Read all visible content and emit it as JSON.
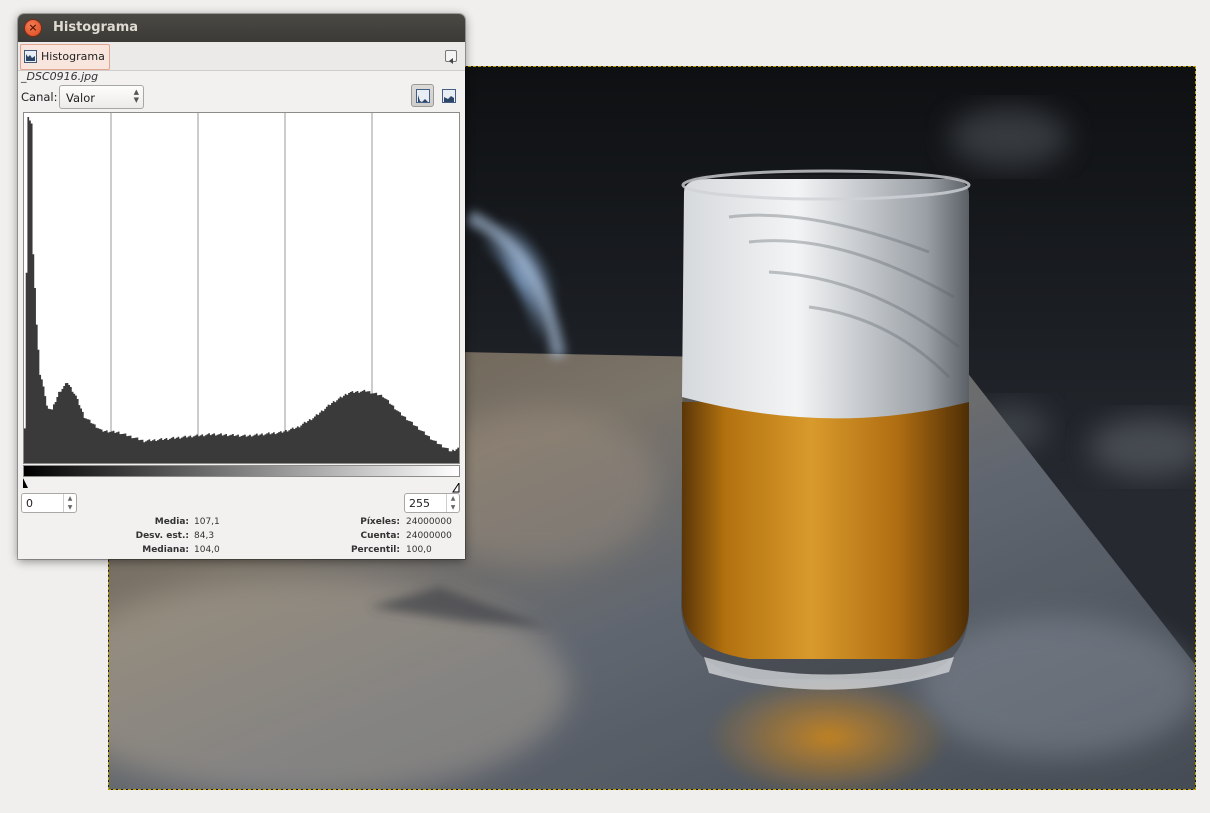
{
  "window": {
    "title": "Histograma"
  },
  "tab": {
    "label": "Histograma"
  },
  "image_name": "_DSC0916.jpg",
  "channel": {
    "label": "Canal:",
    "value": "Valor"
  },
  "range": {
    "low": "0",
    "high": "255"
  },
  "stats": [
    {
      "label": "Media:",
      "value": "107,1"
    },
    {
      "label": "Desv. est.:",
      "value": "84,3"
    },
    {
      "label": "Mediana:",
      "value": "104,0"
    },
    {
      "label": "Píxeles:",
      "value": "24000000"
    },
    {
      "label": "Cuenta:",
      "value": "24000000"
    },
    {
      "label": "Percentil:",
      "value": "100,0"
    }
  ],
  "colors": {
    "titlebar": "#3b3a36",
    "close_button": "#e2562a",
    "histogram_fill": "#3a3a3a",
    "selection_border": "#b8a000"
  },
  "chart_data": {
    "type": "area",
    "x_range": [
      0,
      255
    ],
    "y_scale": "linear",
    "gridlines_x": [
      51,
      102,
      153,
      204
    ],
    "profile": [
      [
        0,
        0.1
      ],
      [
        2,
        1.0
      ],
      [
        4,
        0.98
      ],
      [
        5,
        0.6
      ],
      [
        7,
        0.4
      ],
      [
        9,
        0.25
      ],
      [
        11,
        0.22
      ],
      [
        13,
        0.16
      ],
      [
        16,
        0.15
      ],
      [
        20,
        0.2
      ],
      [
        25,
        0.23
      ],
      [
        30,
        0.19
      ],
      [
        35,
        0.13
      ],
      [
        45,
        0.09
      ],
      [
        55,
        0.085
      ],
      [
        70,
        0.06
      ],
      [
        90,
        0.07
      ],
      [
        110,
        0.08
      ],
      [
        130,
        0.075
      ],
      [
        150,
        0.085
      ],
      [
        160,
        0.1
      ],
      [
        170,
        0.13
      ],
      [
        180,
        0.17
      ],
      [
        190,
        0.2
      ],
      [
        200,
        0.205
      ],
      [
        210,
        0.19
      ],
      [
        220,
        0.14
      ],
      [
        230,
        0.1
      ],
      [
        240,
        0.06
      ],
      [
        250,
        0.03
      ],
      [
        254,
        0.04
      ],
      [
        255,
        0.16
      ]
    ]
  }
}
